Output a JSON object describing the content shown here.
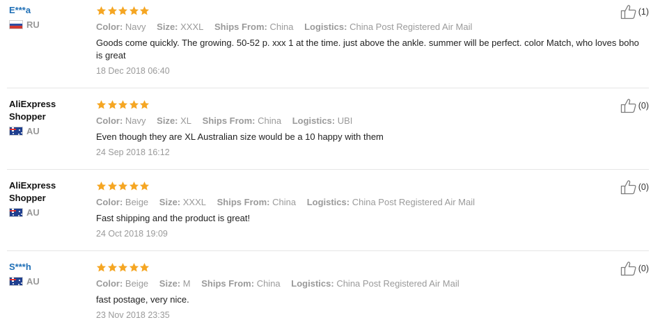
{
  "labels": {
    "color": "Color:",
    "size": "Size:",
    "ships_from": "Ships From:",
    "logistics": "Logistics:"
  },
  "reviews": [
    {
      "user": "E***a",
      "country": "RU",
      "flag": "russia-flag-icon",
      "rating": 5,
      "color": "Navy",
      "size": "XXXL",
      "ships_from": "China",
      "logistics": "China Post Registered Air Mail",
      "text": "Goods come quickly. The growing. 50-52 p. xxx 1 at the time. just above the ankle. summer will be perfect. color Match, who loves boho is great",
      "date": "18 Dec 2018 06:40",
      "helpful": "(1)"
    },
    {
      "user": "AliExpress Shopper",
      "country": "AU",
      "flag": "australia-flag-icon",
      "rating": 5,
      "color": "Navy",
      "size": "XL",
      "ships_from": "China",
      "logistics": "UBI",
      "text": "Even though they are XL Australian size would be a 10 happy with them",
      "date": "24 Sep 2018 16:12",
      "helpful": "(0)"
    },
    {
      "user": "AliExpress Shopper",
      "country": "AU",
      "flag": "australia-flag-icon",
      "rating": 5,
      "color": "Beige",
      "size": "XXXL",
      "ships_from": "China",
      "logistics": "China Post Registered Air Mail",
      "text": "Fast shipping and the product is great!",
      "date": "24 Oct 2018 19:09",
      "helpful": "(0)"
    },
    {
      "user": "S***h",
      "country": "AU",
      "flag": "australia-flag-icon",
      "rating": 5,
      "color": "Beige",
      "size": "M",
      "ships_from": "China",
      "logistics": "China Post Registered Air Mail",
      "text": "fast postage, very nice.",
      "date": "23 Nov 2018 23:35",
      "helpful": "(0)"
    }
  ],
  "colors": {
    "star": "#f5a623",
    "link_user": "#1f6fb6",
    "muted": "#9a9a9a"
  }
}
